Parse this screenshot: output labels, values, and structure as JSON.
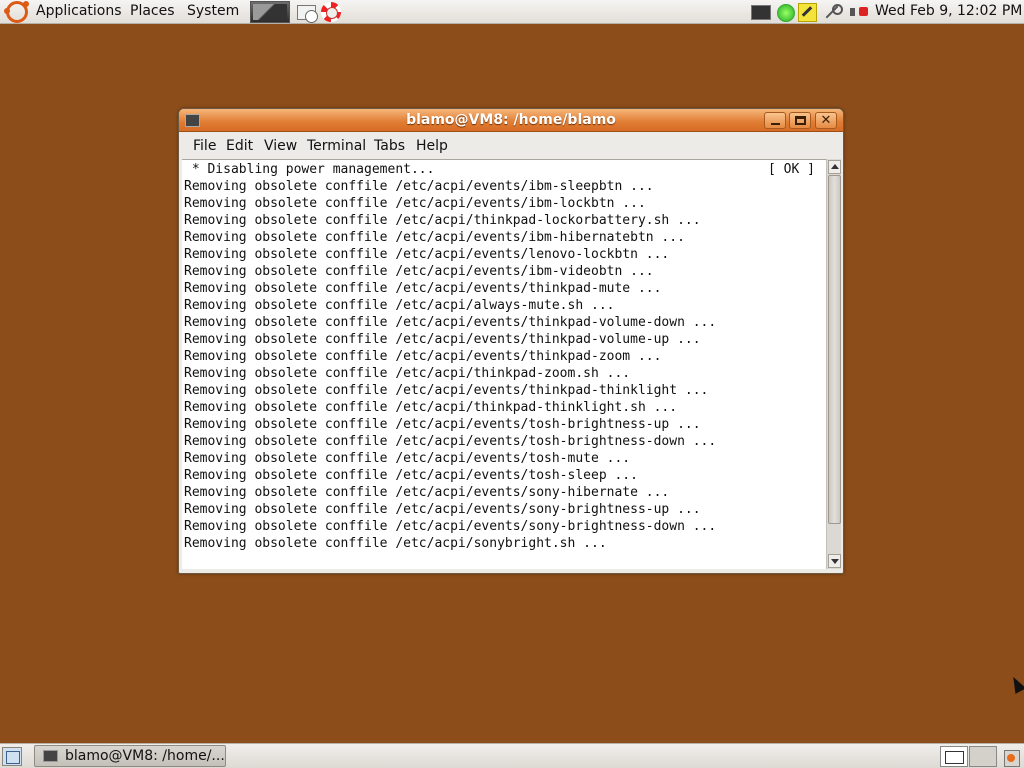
{
  "top_panel": {
    "applications_label": "Applications",
    "places_label": "Places",
    "system_label": "System",
    "clock": "Wed Feb  9, 12:02 PM"
  },
  "window": {
    "title": "blamo@VM8: /home/blamo",
    "menu": {
      "file": "File",
      "edit": "Edit",
      "view": "View",
      "terminal": "Terminal",
      "tabs": "Tabs",
      "help": "Help"
    },
    "ok_badge": "[ OK ]",
    "lines": [
      " * Disabling power management...",
      "Removing obsolete conffile /etc/acpi/events/ibm-sleepbtn ...",
      "Removing obsolete conffile /etc/acpi/events/ibm-lockbtn ...",
      "Removing obsolete conffile /etc/acpi/thinkpad-lockorbattery.sh ...",
      "Removing obsolete conffile /etc/acpi/events/ibm-hibernatebtn ...",
      "Removing obsolete conffile /etc/acpi/events/lenovo-lockbtn ...",
      "Removing obsolete conffile /etc/acpi/events/ibm-videobtn ...",
      "Removing obsolete conffile /etc/acpi/events/thinkpad-mute ...",
      "Removing obsolete conffile /etc/acpi/always-mute.sh ...",
      "Removing obsolete conffile /etc/acpi/events/thinkpad-volume-down ...",
      "Removing obsolete conffile /etc/acpi/events/thinkpad-volume-up ...",
      "Removing obsolete conffile /etc/acpi/events/thinkpad-zoom ...",
      "Removing obsolete conffile /etc/acpi/thinkpad-zoom.sh ...",
      "Removing obsolete conffile /etc/acpi/events/thinkpad-thinklight ...",
      "Removing obsolete conffile /etc/acpi/thinkpad-thinklight.sh ...",
      "Removing obsolete conffile /etc/acpi/events/tosh-brightness-up ...",
      "Removing obsolete conffile /etc/acpi/events/tosh-brightness-down ...",
      "Removing obsolete conffile /etc/acpi/events/tosh-mute ...",
      "Removing obsolete conffile /etc/acpi/events/tosh-sleep ...",
      "Removing obsolete conffile /etc/acpi/events/sony-hibernate ...",
      "Removing obsolete conffile /etc/acpi/events/sony-brightness-up ...",
      "Removing obsolete conffile /etc/acpi/events/sony-brightness-down ...",
      "Removing obsolete conffile /etc/acpi/sonybright.sh ..."
    ]
  },
  "bottom_panel": {
    "task_label": "blamo@VM8: /home/..."
  },
  "colors": {
    "desktop": "#8c4d1a",
    "titlebar": "#e07c33",
    "panel": "#ece9e5"
  },
  "icons": {
    "panel_logo": "ubuntu-logo-icon",
    "launchers": [
      "terminal-launcher-icon",
      "mail-launcher-icon",
      "help-launcher-icon"
    ],
    "tray": [
      "monitor-icon",
      "network-icon",
      "notes-icon",
      "connection-icon",
      "volume-muted-icon"
    ]
  }
}
